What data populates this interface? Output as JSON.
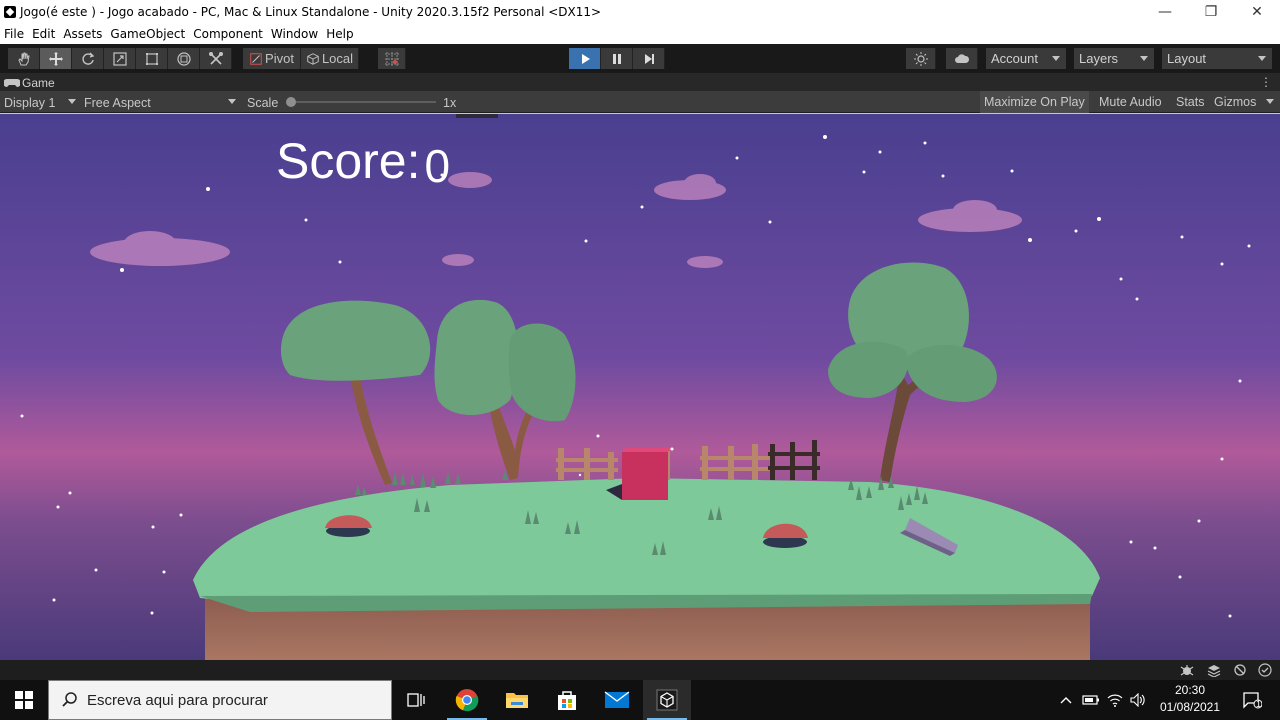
{
  "window": {
    "title": "Jogo(é este ) - Jogo acabado - PC, Mac & Linux Standalone - Unity 2020.3.15f2 Personal <DX11>",
    "controls": {
      "minimize": "—",
      "restore": "❐",
      "close": "✕"
    }
  },
  "menu": [
    "File",
    "Edit",
    "Assets",
    "GameObject",
    "Component",
    "Window",
    "Help"
  ],
  "toolbar": {
    "tools": [
      "hand-tool",
      "move-tool",
      "rotate-tool",
      "scale-tool",
      "rect-tool",
      "transform-tool",
      "custom-tool"
    ],
    "selected_tool": "move-tool",
    "pivot_label": "Pivot",
    "local_label": "Local",
    "account_label": "Account",
    "layers_label": "Layers",
    "layout_label": "Layout",
    "play_state": "playing"
  },
  "game_tab": {
    "label": "Game"
  },
  "game_bar": {
    "display": "Display 1",
    "aspect": "Free Aspect",
    "scale_label": "Scale",
    "scale_value": "1x",
    "maximize_on_play": "Maximize On Play",
    "mute_audio": "Mute Audio",
    "stats": "Stats",
    "gizmos": "Gizmos"
  },
  "hud": {
    "score_label": "Score:",
    "score_value": "0"
  },
  "taskbar": {
    "search_placeholder": "Escreva aqui para procurar",
    "apps": [
      "task-view",
      "chrome",
      "file-explorer",
      "store",
      "mail",
      "unity"
    ],
    "active_app": "unity",
    "time": "20:30",
    "date": "01/08/2021",
    "notification_count": "1"
  },
  "colors": {
    "sky_top": "#4a3f8f",
    "sky_bottom": "#b05a9a",
    "grass": "#7dc99a",
    "cube": "#c8305e",
    "toolbar_bg": "#191919",
    "play_blue": "#3a72b0"
  }
}
